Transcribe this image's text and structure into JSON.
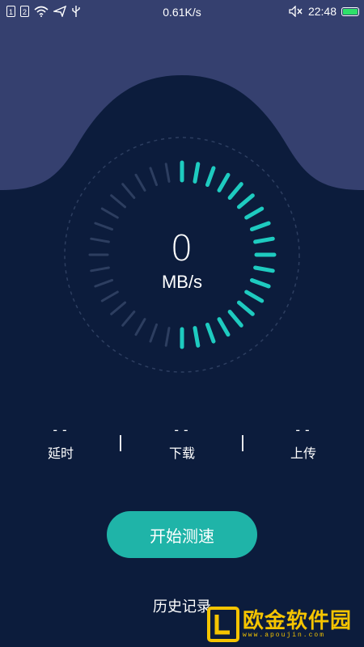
{
  "status_bar": {
    "sim1": "1",
    "sim2": "2",
    "net_speed": "0.61K/s",
    "time": "22:48",
    "icons": [
      "sim-1-icon",
      "sim-2-icon",
      "wifi-icon",
      "location-arrow-icon",
      "usb-icon",
      "mute-icon",
      "battery-icon"
    ],
    "battery_color": "#2ee06a"
  },
  "speed": {
    "value": "0",
    "unit": "MB/s"
  },
  "gauge": {
    "active_color": "#1ecbc0",
    "inactive_color": "#2d3e60"
  },
  "metrics": [
    {
      "value": "--",
      "label": "延时"
    },
    {
      "value": "--",
      "label": "下载"
    },
    {
      "value": "--",
      "label": "上传"
    }
  ],
  "start_button": {
    "label": "开始测速"
  },
  "history": {
    "label": "历史记录"
  },
  "watermark": {
    "title": "欧金软件园",
    "subtitle": "www.apoujin.com"
  },
  "colors": {
    "background": "#0c1c3c",
    "header": "#35406f",
    "accent": "#1fb4a8"
  }
}
